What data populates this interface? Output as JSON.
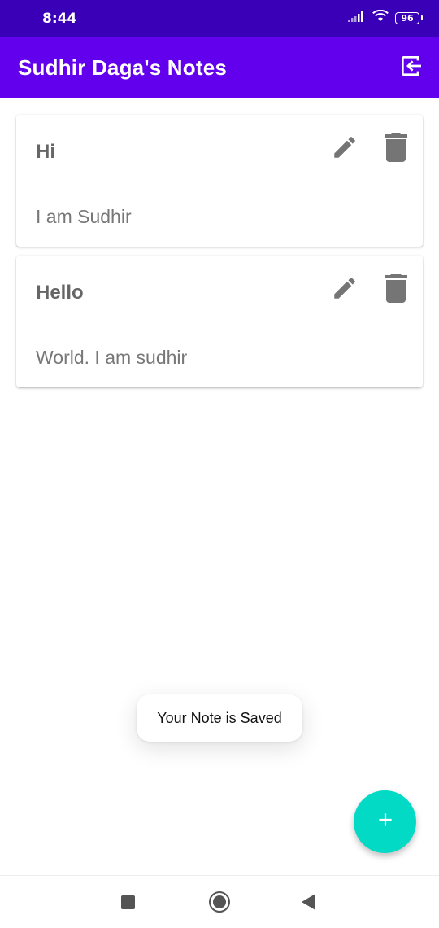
{
  "status_bar": {
    "time": "8:44",
    "battery": "96",
    "icons": [
      "signal-icon",
      "wifi-icon",
      "battery-icon"
    ]
  },
  "app_bar": {
    "title": "Sudhir Daga's Notes",
    "action_icon": "logout-icon"
  },
  "notes": [
    {
      "title": "Hi",
      "body": "I am Sudhir"
    },
    {
      "title": "Hello",
      "body": "World. I am sudhir"
    }
  ],
  "toast": {
    "message": "Your Note is Saved"
  },
  "fab": {
    "icon": "add-icon"
  },
  "colors": {
    "status_bar": "#3a00b8",
    "primary": "#6200ee",
    "accent": "#03dac5",
    "icon_gray": "#757575"
  },
  "navigation": {
    "icons": [
      "recent-apps-icon",
      "home-icon",
      "back-icon"
    ]
  }
}
